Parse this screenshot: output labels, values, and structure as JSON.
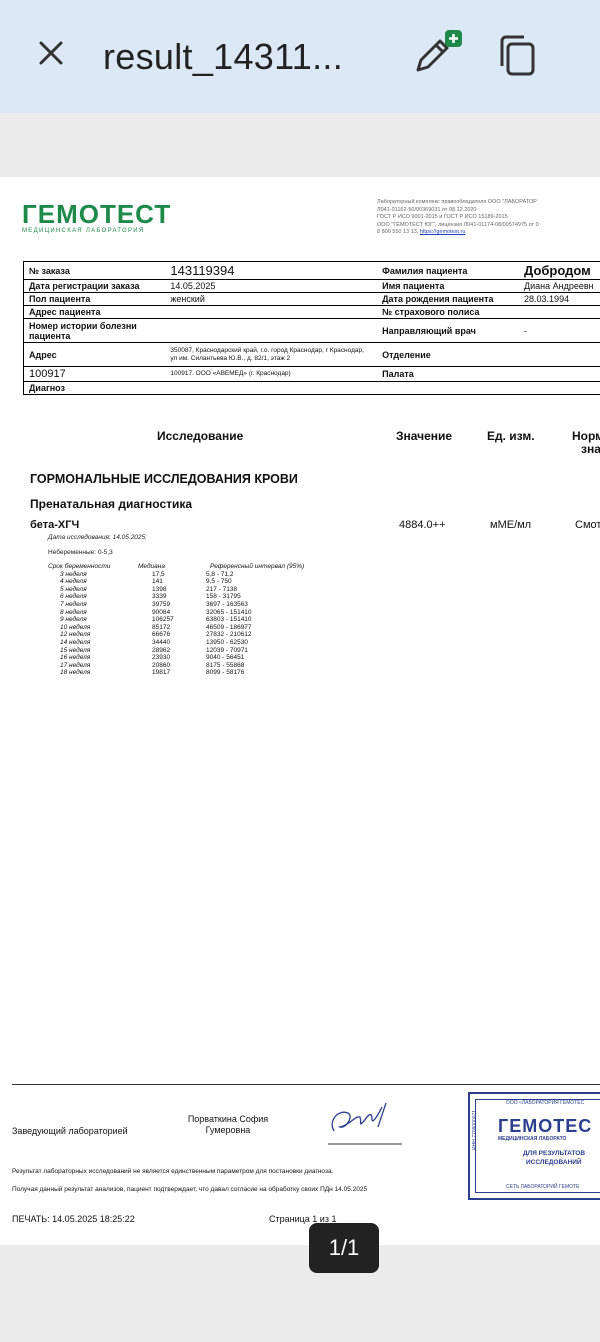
{
  "toolbar": {
    "title": "result_14311..."
  },
  "colors": {
    "brand": "#1e8a4a",
    "toolbar_bg": "#dde8f7",
    "stamp": "#2b3f8e"
  },
  "icons": {
    "close": "close-icon",
    "edit": "pen-add-icon",
    "copy": "copy-icon"
  },
  "document": {
    "logo": {
      "name": "ГЕМОТЕСТ",
      "tagline": "МЕДИЦИНСКАЯ ЛАБОРАТОРИЯ"
    },
    "lab_info": [
      "Лабораторный комплекс правообладателя ООО \"ЛАБОРАТОР",
      "Л041-01162-50/00369031 от 08.12.2020",
      "ГОСТ Р ИСО 9001-2015 и ГОСТ Р ИСО 15189-2015",
      "ООО \"ГЕМОТЕСТ ЮГ\", лицензия Л041-01174-08/00574975 от 0",
      "8 800 550 13 13,",
      "https://gemotest.ru"
    ],
    "patient": {
      "order_label": "№ заказа",
      "order_value": "143119394",
      "surname_label": "Фамилия пациента",
      "surname_value": "Добродом",
      "reg_date_label": "Дата регистрации заказа",
      "reg_date_value": "14.05.2025",
      "name_label": "Имя пациента",
      "name_value": "Диана Андреевн",
      "sex_label": "Пол пациента",
      "sex_value": "женский",
      "birth_label": "Дата рождения пациента",
      "birth_value": "28.03.1994",
      "address_label": "Адрес пациента",
      "address_value": "",
      "policy_label": "№ страхового полиса",
      "policy_value": "",
      "history_label": "Номер истории болезни пациента",
      "history_value": "",
      "doctor_label": "Направляющий врач",
      "doctor_value": "-",
      "addr_label": "Адрес",
      "addr_value": "350087, Краснодарский край, г.о. город Краснодар, г Краснодар, ул им. Силантьева Ю.В., д. 82/1, этаж 2",
      "dept_label": "Отделение",
      "dept_value": "",
      "code_label": "100917",
      "code_value": "100917. ООО «АВЕМЕД» (г. Краснодар)",
      "ward_label": "Палата",
      "ward_value": "",
      "diag_label": "Диагноз",
      "diag_value": ""
    },
    "columns": {
      "test": "Исследование",
      "value": "Значение",
      "unit": "Ед. изм.",
      "norm": "Норм",
      "norm2": "зна"
    },
    "section": "ГОРМОНАЛЬНЫЕ ИССЛЕДОВАНИЯ КРОВИ",
    "subsection": "Пренатальная диагностика",
    "test": {
      "name": "бета-ХГЧ",
      "value": "4884.0++",
      "unit": "мМЕ/мл",
      "norm": "Смот",
      "date": "Дата исследования: 14.05.2025;",
      "nonpregnant": "Небеременные: 0-5,3",
      "ref_headers": [
        "Срок беременности",
        "Медиана",
        "Референсный интервал (95%)"
      ],
      "ref_rows": [
        [
          "3 неделя",
          "17,5",
          "5,8 - 71,2"
        ],
        [
          "4 неделя",
          "141",
          "9,5 - 750"
        ],
        [
          "5 неделя",
          "1398",
          "217 - 7138"
        ],
        [
          "6 неделя",
          "3339",
          "158 - 31795"
        ],
        [
          "7 неделя",
          "39759",
          "3697 - 163563"
        ],
        [
          "8 неделя",
          "90084",
          "32065 - 151410"
        ],
        [
          "9 неделя",
          "106257",
          "63803 - 151410"
        ],
        [
          "10 неделя",
          "85172",
          "46509 - 186977"
        ],
        [
          "12 неделя",
          "66676",
          "27832 - 210612"
        ],
        [
          "14 неделя",
          "34440",
          "13950 - 62530"
        ],
        [
          "15 неделя",
          "28962",
          "12039 - 70971"
        ],
        [
          "16 неделя",
          "23930",
          "9040 - 56451"
        ],
        [
          "17 неделя",
          "20860",
          "8175 - 55868"
        ],
        [
          "18 неделя",
          "19817",
          "8099 - 58176"
        ]
      ]
    },
    "footer": {
      "head_label": "Заведующий лабораторией",
      "head_name": "Порваткина София Гумеровна",
      "disclaimer1": "Результат лабораторных исследований не является единственным параметром для постановки диагноза.",
      "disclaimer2": "Получая данный результат анализов, пациент подтверждает, что давал согласие на обработку своих ПДн 14.05.2025",
      "print": "ПЕЧАТЬ: 14.05.2025 18:25:22",
      "page": "Страница 1 из 1"
    },
    "stamp": {
      "top": "ООО «ЛАБОРАТОРИЯ ГЕМОТЕС",
      "name": "ГЕМОТЕС",
      "sub": "МЕДИЦИНСКАЯ ЛАБОРАТО",
      "mid1": "ДЛЯ РЕЗУЛЬТАТОВ",
      "mid2": "ИССЛЕДОВАНИЙ",
      "side": "ИНН 7708000071",
      "bottom": "СЕТЬ ЛАБОРАТОРИЙ ГЕМОТЕ"
    }
  },
  "page_indicator": "1/1"
}
